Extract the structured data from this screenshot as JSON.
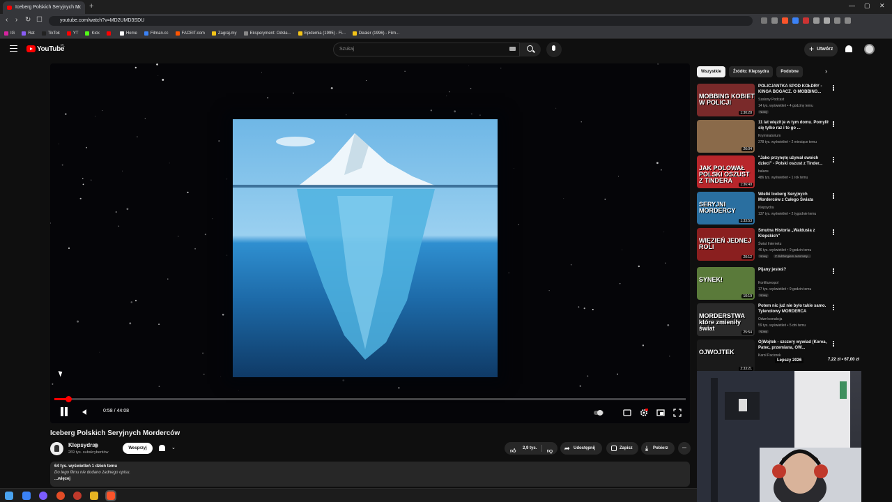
{
  "browser": {
    "tab_title": "Iceberg Polskich Seryjnych M",
    "url": "youtube.com/watch?v=MD2UMD3SDU",
    "bookmarks": [
      {
        "label": "IG",
        "color": "#d6249f"
      },
      {
        "label": "Rat",
        "color": "#8a5cf6"
      },
      {
        "label": "TikTok",
        "color": "#222222"
      },
      {
        "label": "YT",
        "color": "#ff0000"
      },
      {
        "label": "Kick",
        "color": "#53fc18"
      },
      {
        "label": "",
        "color": "#ff0000"
      },
      {
        "label": "Home",
        "color": "#ffffff"
      },
      {
        "label": "Filman.cc",
        "color": "#3b82f6"
      },
      {
        "label": "FACEIT.com",
        "color": "#ff5500"
      },
      {
        "label": "Zagraj.my",
        "color": "#f5c518"
      },
      {
        "label": "Eksperyment: Odsła...",
        "color": "#888888"
      },
      {
        "label": "Epidemia (1995) - Fi...",
        "color": "#f5c518"
      },
      {
        "label": "Dealer (1996) - Film...",
        "color": "#f5c518"
      }
    ]
  },
  "header": {
    "logo_text": "YouTube",
    "region": "PL",
    "search_placeholder": "Szukaj",
    "create_label": "Utwórz"
  },
  "player": {
    "current_time": "0:58",
    "duration": "44:08",
    "time_display": "0:58 / 44:08",
    "progress_fraction": 0.022
  },
  "video": {
    "title": "Iceberg Polskich Seryjnych Morderców",
    "channel": "Klepsydra",
    "subscribers": "269 tys. subskrybentów",
    "join_label": "Wesprzyj",
    "likes": "2,9 tys.",
    "share_label": "Udostępnij",
    "save_label": "Zapisz",
    "download_label": "Pobierz",
    "stats": "64 tys. wyświetleń  1 dzień temu",
    "description": "Do tego filmu nie dodano żadnego opisu.",
    "more_label": "...więcej"
  },
  "sidebar": {
    "chips": [
      "Wszystkie",
      "Źródło: Klepsydra",
      "Podobne"
    ],
    "recommendations": [
      {
        "title": "POLICJANTKA SPOD KOŁDRY - KINGA BOGACZ. O MOBBING...",
        "channel": "Szalony Podcast",
        "meta": "14 tys. wyświetleń • 4 godziny temu",
        "badge": "Nowy",
        "duration": "1:30:28",
        "thumb_text": "MOBBING KOBIET W POLICJI",
        "bg": "#7a2a2a"
      },
      {
        "title": "11 lat więził je w tym domu. Pomylił się tylko raz i to go ...",
        "channel": "Kryminatorium",
        "meta": "278 tys. wyświetleń • 2 miesiące temu",
        "badge": "",
        "duration": "26:04",
        "thumb_text": "",
        "bg": "#8a6a4a"
      },
      {
        "title": "\"Jako przynętę używał swoich dzieci\" - Polski oszust z Tinder...",
        "channel": "balans",
        "meta": "486 tys. wyświetleń • 1 rok temu",
        "badge": "",
        "duration": "1:36:40",
        "thumb_text": "JAK POLOWAŁ POLSKI OSZUST Z TINDERA",
        "bg": "#b8262b"
      },
      {
        "title": "Wielki Iceberg Seryjnych Morderców z Całego Świata",
        "channel": "Klepsydra",
        "meta": "137 tys. wyświetleń • 2 tygodnie temu",
        "badge": "",
        "duration": "1:33:53",
        "thumb_text": "SERYJNI MORDERCY",
        "bg": "#2a6fa0"
      },
      {
        "title": "Smutna Historia „Waldusia z Klepskich\"",
        "channel": "Świat Internetu",
        "meta": "46 tys. wyświetleń • 9 godzin temu",
        "badge": "Nowy",
        "badge2": "Z dubbingiem automaty...",
        "duration": "20:12",
        "thumb_text": "WIĘZIEŃ JEDNEJ ROLI",
        "bg": "#8a1f1f"
      },
      {
        "title": "Pijany jesteś?",
        "channel": "Konfiturexpol",
        "meta": "17 tys. wyświetleń • 9 godzin temu",
        "badge": "Nowy",
        "duration": "10:19",
        "thumb_text": "SYNEK!",
        "bg": "#5a7a3a"
      },
      {
        "title": "Potem nic już nie było takie samo. Tylenolowy MORDERCA",
        "channel": "Odwróconakcja",
        "meta": "59 tys. wyświetleń • 5 dni temu",
        "badge": "Nowy",
        "duration": "25:54",
        "thumb_text": "MORDERSTWA które zmieniły świat",
        "bg": "#2a2a2a"
      },
      {
        "title": "OjWojtek - szczery wywiad (Korea, Patec, przemiana, OW...",
        "channel": "Karol Paciorek",
        "meta": "",
        "badge": "",
        "duration": "2:33:21",
        "thumb_text": "OJWOJTEK",
        "bg": "#1a1a1a"
      }
    ]
  },
  "overlay": {
    "label": "Lepszy 2026",
    "price": "7,22 zł • 67,00 zł"
  },
  "colors": {
    "accent": "#ff0000",
    "background": "#0f0f0f",
    "chip_bg": "#272727"
  }
}
